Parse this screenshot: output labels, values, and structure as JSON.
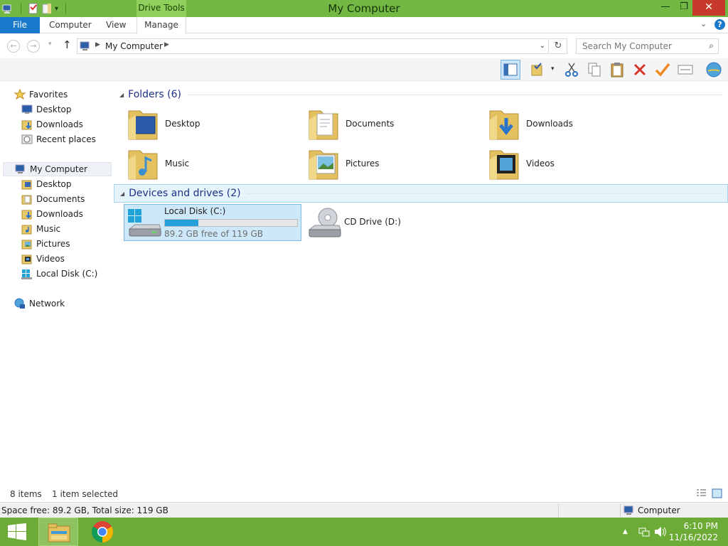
{
  "window": {
    "title": "My Computer",
    "contextual_tab_group": "Drive Tools",
    "minimize": "—",
    "maximize": "❐",
    "close": "✕"
  },
  "ribbon": {
    "tabs": [
      "File",
      "Computer",
      "View",
      "Manage"
    ],
    "help": "?",
    "expand": "⌄"
  },
  "address": {
    "crumb": "My Computer",
    "search_placeholder": "Search My Computer"
  },
  "nav": {
    "favorites_label": "Favorites",
    "favorites": [
      "Desktop",
      "Downloads",
      "Recent places"
    ],
    "computer_label": "My Computer",
    "computer_items": [
      "Desktop",
      "Documents",
      "Downloads",
      "Music",
      "Pictures",
      "Videos",
      "Local Disk (C:)"
    ],
    "network_label": "Network"
  },
  "content": {
    "folders_header": "Folders (6)",
    "folders": [
      "Desktop",
      "Documents",
      "Downloads",
      "Music",
      "Pictures",
      "Videos"
    ],
    "drives_header": "Devices and drives (2)",
    "drives": [
      {
        "name": "Local Disk (C:)",
        "free": "89.2 GB free of 119 GB",
        "used_fraction": 0.25
      },
      {
        "name": "CD Drive (D:)"
      }
    ]
  },
  "status": {
    "items": "8 items",
    "selected": "1 item selected",
    "space": "Space free: 89.2 GB, Total size: 119 GB",
    "location": "Computer"
  },
  "taskbar": {
    "time": "6:10 PM",
    "date": "11/16/2022"
  },
  "colors": {
    "titlebar": "#74b844",
    "taskbar": "#6cab36",
    "file_tab": "#1979ca",
    "selection": "#cde8f8",
    "close": "#c7392b"
  }
}
